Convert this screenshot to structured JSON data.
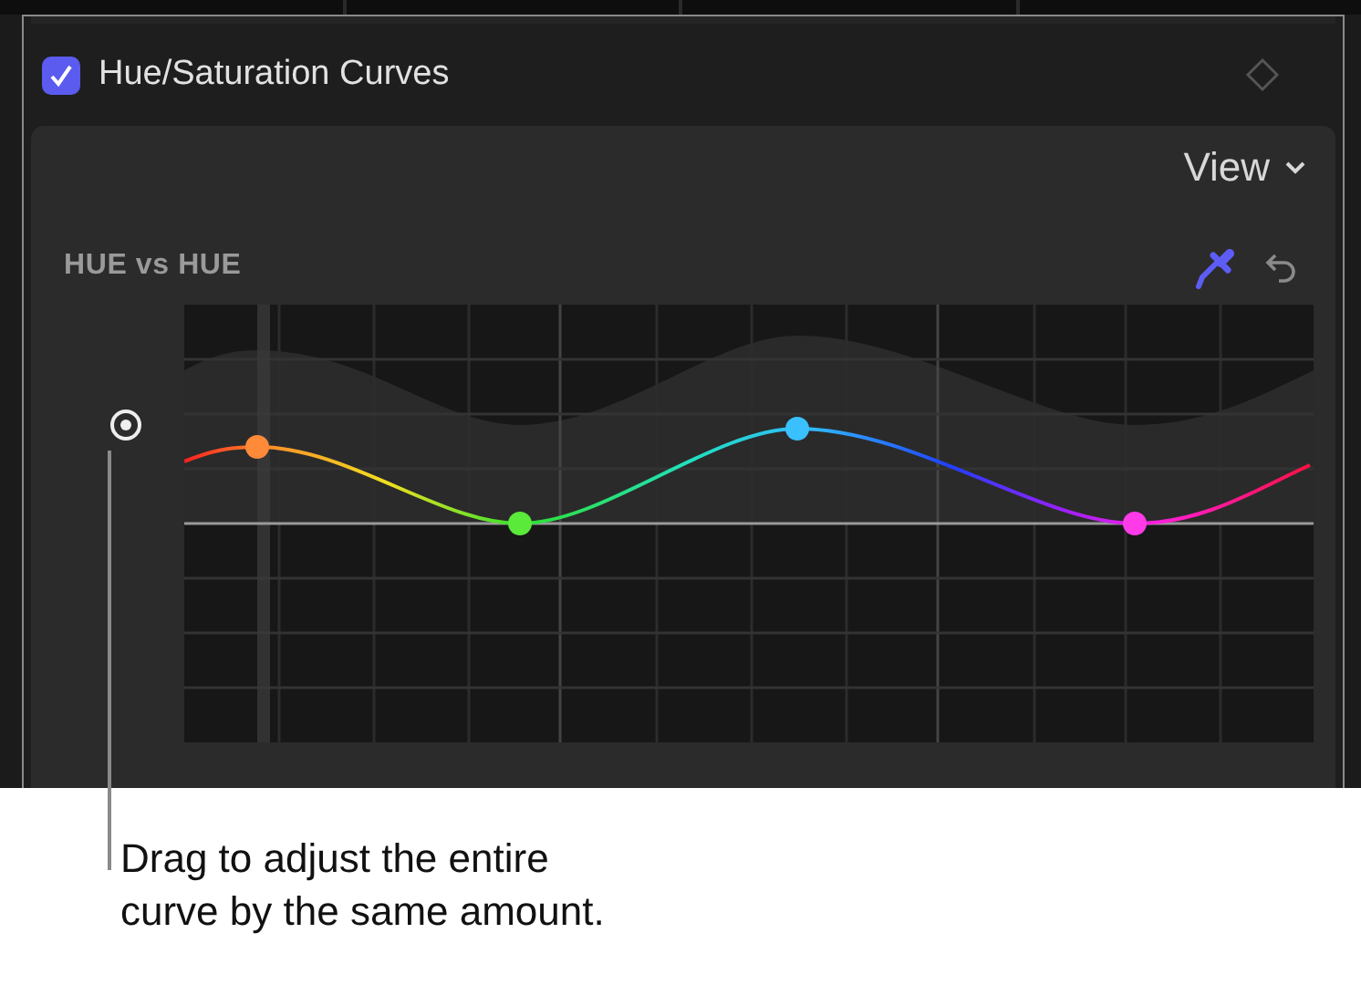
{
  "panel": {
    "title": "Hue/Saturation Curves",
    "enabled": true
  },
  "view_menu": {
    "label": "View"
  },
  "curve": {
    "label": "HUE vs HUE"
  },
  "callout": {
    "lines": [
      "Drag to adjust the entire",
      "curve by the same amount."
    ]
  }
}
